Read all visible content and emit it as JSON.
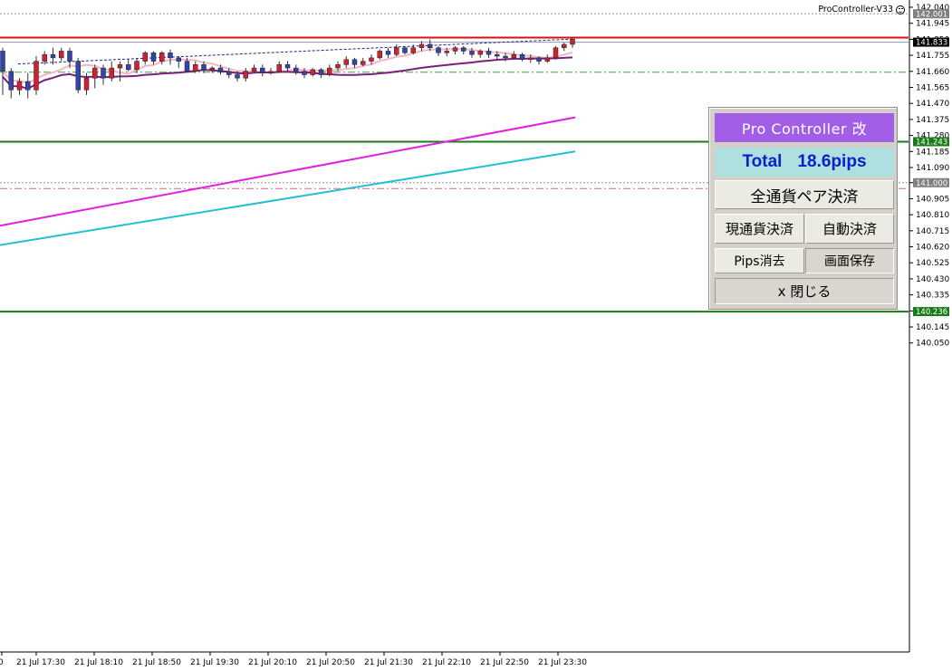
{
  "indicator": {
    "label": "ProController-V33",
    "icon": "smiley-icon"
  },
  "panel": {
    "title": "Pro Controller 改",
    "total_label": "Total",
    "total_value": "18.6pips",
    "all_pairs_close": "全通貨ペア決済",
    "current_pair_close": "現通貨決済",
    "auto_close": "自動決済",
    "pips_clear": "Pips消去",
    "screen_save": "画面保存",
    "close_panel": "x 閉じる",
    "colors": {
      "title_bg": "#a35ee8",
      "total_bg": "#aee0e0",
      "total_text": "#0b20c8"
    }
  },
  "price_axis": {
    "ticks": [
      "142.040",
      "141.945",
      "141.850",
      "141.755",
      "141.660",
      "141.565",
      "141.470",
      "141.375",
      "141.280",
      "141.185",
      "141.090",
      "141.000",
      "140.905",
      "140.810",
      "140.715",
      "140.620",
      "140.525",
      "140.430",
      "140.335",
      "140.240",
      "140.145",
      "140.050"
    ],
    "tags": [
      {
        "price": "142.001",
        "color": "#808080",
        "line": "#999999",
        "style": "dotted"
      },
      {
        "price": "141.833",
        "color": "#000000",
        "line": "#1f3d8a",
        "style": "solid"
      },
      {
        "price": "141.243",
        "color": "#1a7a1a",
        "line": "#1a7a1a",
        "style": "solid"
      },
      {
        "price": "141.000",
        "color": "#808080",
        "line": "#999999",
        "style": "dotted"
      },
      {
        "price": "140.236",
        "color": "#1a7a1a",
        "line": "#1a7a1a",
        "style": "solid"
      }
    ]
  },
  "time_axis": {
    "labels": [
      "0",
      "21 Jul 17:30",
      "21 Jul 18:10",
      "21 Jul 18:50",
      "21 Jul 19:30",
      "21 Jul 20:10",
      "21 Jul 20:50",
      "21 Jul 21:30",
      "21 Jul 22:10",
      "21 Jul 22:50",
      "21 Jul 23:30"
    ]
  },
  "colors": {
    "bull_candle": "#cc2233",
    "bear_candle": "#3344aa",
    "ma_fast": "#f2b6c4",
    "ma_slow": "#7a1f7a",
    "magenta_line": "#e020e0",
    "cyan_line": "#22c0d0",
    "red_line": "#dd1111",
    "green_line": "#1a7a1a"
  },
  "chart": {
    "red_resistance": 141.86,
    "green_dashdot": 141.655,
    "pink_dashdot": 140.965,
    "trend_dotted": [
      141.72,
      141.852
    ],
    "magenta_line": [
      140.745,
      141.387
    ],
    "cyan_line": [
      140.63,
      141.185
    ],
    "candles": [
      [
        141.78,
        141.66,
        141.8,
        141.52
      ],
      [
        141.66,
        141.55,
        141.68,
        141.5
      ],
      [
        141.55,
        141.6,
        141.62,
        141.52
      ],
      [
        141.6,
        141.55,
        141.65,
        141.5
      ],
      [
        141.55,
        141.72,
        141.75,
        141.52
      ],
      [
        141.72,
        141.76,
        141.78,
        141.7
      ],
      [
        141.76,
        141.74,
        141.8,
        141.7
      ],
      [
        141.74,
        141.78,
        141.8,
        141.72
      ],
      [
        141.78,
        141.72,
        141.8,
        141.68
      ],
      [
        141.72,
        141.55,
        141.74,
        141.53
      ],
      [
        141.55,
        141.62,
        141.65,
        141.52
      ],
      [
        141.62,
        141.68,
        141.7,
        141.56
      ],
      [
        141.68,
        141.62,
        141.7,
        141.58
      ],
      [
        141.62,
        141.68,
        141.72,
        141.6
      ],
      [
        141.68,
        141.7,
        141.72,
        141.6
      ],
      [
        141.7,
        141.67,
        141.73,
        141.66
      ],
      [
        141.67,
        141.72,
        141.74,
        141.65
      ],
      [
        141.72,
        141.77,
        141.78,
        141.7
      ],
      [
        141.77,
        141.72,
        141.78,
        141.7
      ],
      [
        141.72,
        141.77,
        141.78,
        141.7
      ],
      [
        141.77,
        141.74,
        141.79,
        141.7
      ],
      [
        141.74,
        141.72,
        141.75,
        141.68
      ],
      [
        141.72,
        141.66,
        141.74,
        141.65
      ],
      [
        141.66,
        141.7,
        141.72,
        141.65
      ],
      [
        141.7,
        141.67,
        141.72,
        141.65
      ],
      [
        141.67,
        141.68,
        141.69,
        141.65
      ],
      [
        141.68,
        141.66,
        141.7,
        141.64
      ],
      [
        141.66,
        141.64,
        141.68,
        141.62
      ],
      [
        141.64,
        141.62,
        141.66,
        141.6
      ],
      [
        141.62,
        141.66,
        141.68,
        141.6
      ],
      [
        141.66,
        141.68,
        141.7,
        141.65
      ],
      [
        141.68,
        141.65,
        141.7,
        141.63
      ],
      [
        141.65,
        141.66,
        141.68,
        141.64
      ],
      [
        141.66,
        141.7,
        141.72,
        141.65
      ],
      [
        141.7,
        141.68,
        141.72,
        141.66
      ],
      [
        141.68,
        141.66,
        141.7,
        141.64
      ],
      [
        141.66,
        141.64,
        141.68,
        141.62
      ],
      [
        141.64,
        141.67,
        141.68,
        141.63
      ],
      [
        141.67,
        141.64,
        141.68,
        141.62
      ],
      [
        141.64,
        141.68,
        141.7,
        141.63
      ],
      [
        141.68,
        141.7,
        141.72,
        141.66
      ],
      [
        141.7,
        141.73,
        141.75,
        141.68
      ],
      [
        141.73,
        141.7,
        141.74,
        141.68
      ],
      [
        141.7,
        141.72,
        141.74,
        141.69
      ],
      [
        141.72,
        141.74,
        141.76,
        141.7
      ],
      [
        141.74,
        141.78,
        141.79,
        141.73
      ],
      [
        141.78,
        141.76,
        141.8,
        141.74
      ],
      [
        141.76,
        141.8,
        141.82,
        141.75
      ],
      [
        141.8,
        141.77,
        141.81,
        141.76
      ],
      [
        141.77,
        141.8,
        141.82,
        141.76
      ],
      [
        141.8,
        141.82,
        141.84,
        141.78
      ],
      [
        141.82,
        141.8,
        141.85,
        141.78
      ],
      [
        141.8,
        141.77,
        141.81,
        141.75
      ],
      [
        141.77,
        141.78,
        141.8,
        141.75
      ],
      [
        141.78,
        141.8,
        141.81,
        141.76
      ],
      [
        141.8,
        141.78,
        141.81,
        141.76
      ],
      [
        141.78,
        141.76,
        141.8,
        141.74
      ],
      [
        141.76,
        141.78,
        141.79,
        141.74
      ],
      [
        141.78,
        141.76,
        141.8,
        141.74
      ],
      [
        141.76,
        141.75,
        141.78,
        141.73
      ],
      [
        141.75,
        141.74,
        141.77,
        141.72
      ],
      [
        141.74,
        141.76,
        141.78,
        141.73
      ],
      [
        141.76,
        141.73,
        141.77,
        141.72
      ],
      [
        141.73,
        141.74,
        141.76,
        141.71
      ],
      [
        141.74,
        141.72,
        141.75,
        141.7
      ],
      [
        141.72,
        141.74,
        141.76,
        141.71
      ],
      [
        141.74,
        141.8,
        141.81,
        141.73
      ],
      [
        141.8,
        141.82,
        141.83,
        141.78
      ],
      [
        141.82,
        141.85,
        141.86,
        141.8
      ]
    ]
  }
}
